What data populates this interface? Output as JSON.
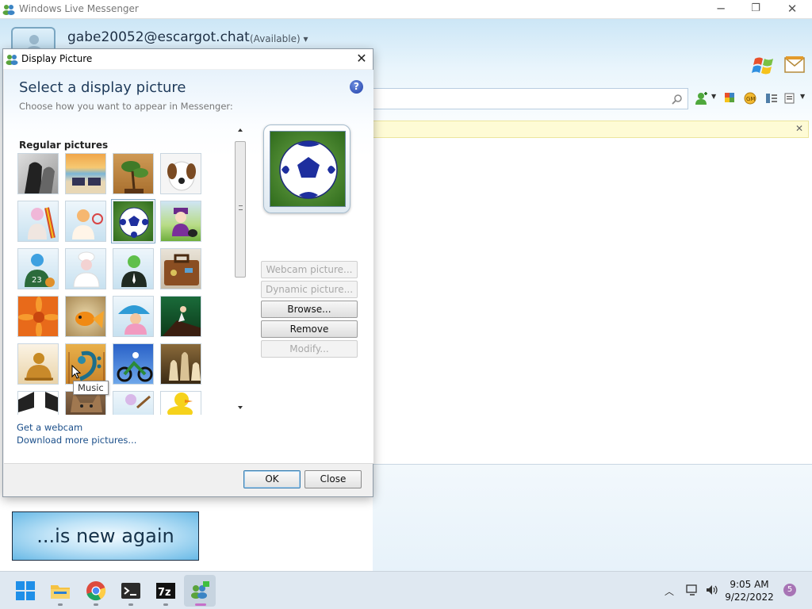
{
  "window": {
    "title": "Windows Live Messenger",
    "minimize": "─",
    "maximize": "❐",
    "close": "✕"
  },
  "account": {
    "email": "gabe20052@escargot.chat",
    "status": "(Available)",
    "status_arrow": "▾"
  },
  "search": {
    "icon": "search-icon"
  },
  "infobar": {
    "close": "✕"
  },
  "promo": {
    "text": "...is new again"
  },
  "dialog": {
    "title": "Display Picture",
    "close": "✕",
    "heading": "Select a display picture",
    "subheading": "Choose how you want to appear in Messenger:",
    "help": "?",
    "section": "Regular pictures",
    "tooltip": "Music",
    "selected": "soccer-ball",
    "pictures": [
      "horses",
      "beach-chairs",
      "bonsai",
      "dog",
      "surfboard-figure",
      "tennis-figure",
      "soccer-ball",
      "snowboarder-kid",
      "basketball-figure",
      "chef-figure",
      "business-figure",
      "suitcase",
      "daisy",
      "goldfish",
      "beach-ball-figure",
      "mountain-climber",
      "buddha-figure",
      "music",
      "dirt-bike",
      "chess",
      "soccer-figure",
      "kitten",
      "guitar-figure",
      "rubber-duck"
    ],
    "buttons": {
      "webcam": "Webcam picture...",
      "dynamic": "Dynamic picture...",
      "browse": "Browse...",
      "remove": "Remove",
      "modify": "Modify..."
    },
    "links": {
      "webcam": "Get a webcam",
      "download": "Download more pictures..."
    },
    "ok": "OK",
    "cancel": "Close"
  },
  "taskbar": {
    "time": "9:05 AM",
    "date": "9/22/2022",
    "notifications": "5",
    "apps": [
      "start",
      "file-explorer",
      "chrome",
      "terminal",
      "7zip",
      "messenger"
    ]
  }
}
